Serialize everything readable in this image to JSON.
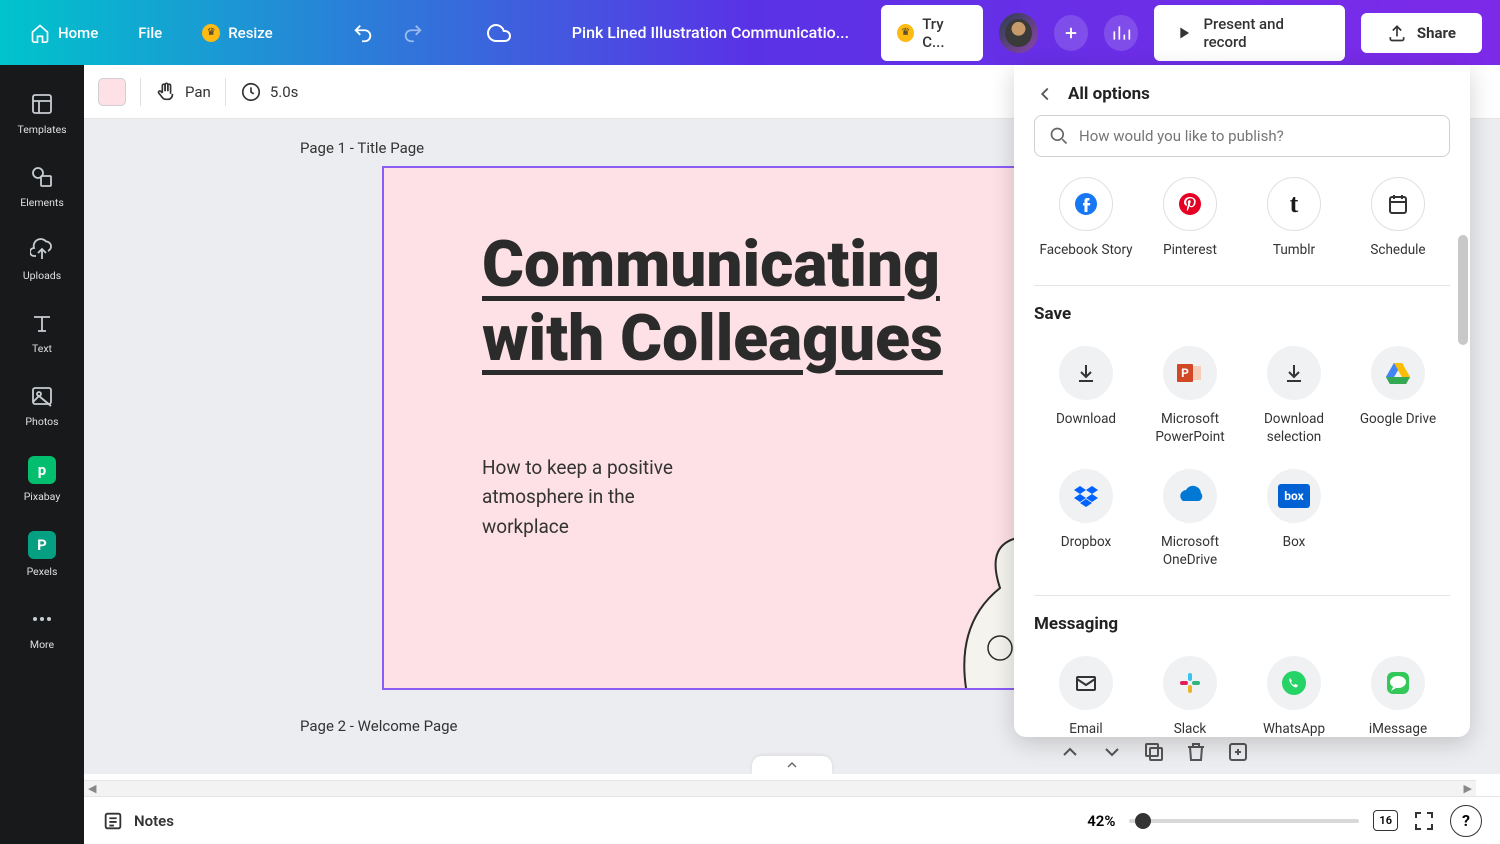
{
  "header": {
    "home": "Home",
    "file": "File",
    "resize": "Resize",
    "doc_title": "Pink Lined Illustration Communicatio...",
    "try_canva": "Try C...",
    "present": "Present and record",
    "share": "Share"
  },
  "sidebar": {
    "items": [
      {
        "label": "Templates"
      },
      {
        "label": "Elements"
      },
      {
        "label": "Uploads"
      },
      {
        "label": "Text"
      },
      {
        "label": "Photos"
      },
      {
        "label": "Pixabay"
      },
      {
        "label": "Pexels"
      },
      {
        "label": "More"
      }
    ]
  },
  "toolbar2": {
    "pan": "Pan",
    "duration": "5.0s"
  },
  "canvas": {
    "page1_label": "Page 1 - Title Page",
    "page2_label": "Page 2 - Welcome Page",
    "slide": {
      "title_line1": "Communicating",
      "title_line2": "with Colleagues",
      "subtitle": "How to keep a positive atmosphere in the workplace"
    }
  },
  "bottom": {
    "notes": "Notes",
    "zoom": "42%",
    "grid_badge": "16"
  },
  "share_panel": {
    "title": "All options",
    "search_placeholder": "How would you like to publish?",
    "social": [
      {
        "label": "Facebook Story"
      },
      {
        "label": "Pinterest"
      },
      {
        "label": "Tumblr"
      },
      {
        "label": "Schedule"
      }
    ],
    "save_title": "Save",
    "save": [
      {
        "label": "Download"
      },
      {
        "label": "Microsoft PowerPoint"
      },
      {
        "label": "Download selection"
      },
      {
        "label": "Google Drive"
      },
      {
        "label": "Dropbox"
      },
      {
        "label": "Microsoft OneDrive"
      },
      {
        "label": "Box"
      }
    ],
    "messaging_title": "Messaging",
    "messaging": [
      {
        "label": "Email"
      },
      {
        "label": "Slack"
      },
      {
        "label": "WhatsApp"
      },
      {
        "label": "iMessage"
      }
    ]
  }
}
